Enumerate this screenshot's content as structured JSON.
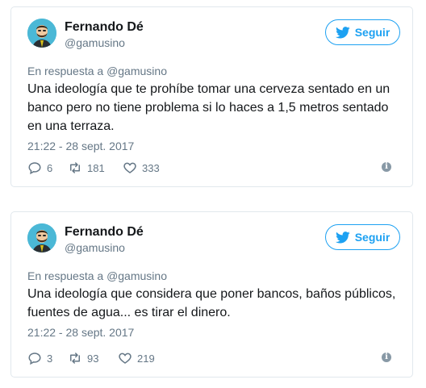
{
  "colors": {
    "accent": "#1da1f2",
    "muted": "#657786",
    "text": "#14171a",
    "border": "#e1e8ed"
  },
  "tweets": [
    {
      "author_name": "Fernando Dé",
      "author_handle": "@gamusino",
      "follow_label": "Seguir",
      "reply_prefix": "En respuesta a",
      "reply_handle": "@gamusino",
      "text": "Una ideología que te prohíbe tomar una cerveza sentado en un banco pero no tiene problema si lo haces a 1,5 metros sentado en una terraza.",
      "timestamp": "21:22 - 28 sept. 2017",
      "replies": "6",
      "retweets": "181",
      "likes": "333",
      "info_icon": "info-icon"
    },
    {
      "author_name": "Fernando Dé",
      "author_handle": "@gamusino",
      "follow_label": "Seguir",
      "reply_prefix": "En respuesta a",
      "reply_handle": "@gamusino",
      "text": "Una ideología que considera que poner bancos, baños públicos, fuentes de agua... es tirar el dinero.",
      "timestamp": "21:22 - 28 sept. 2017",
      "replies": "3",
      "retweets": "93",
      "likes": "219",
      "info_icon": "info-icon"
    }
  ]
}
